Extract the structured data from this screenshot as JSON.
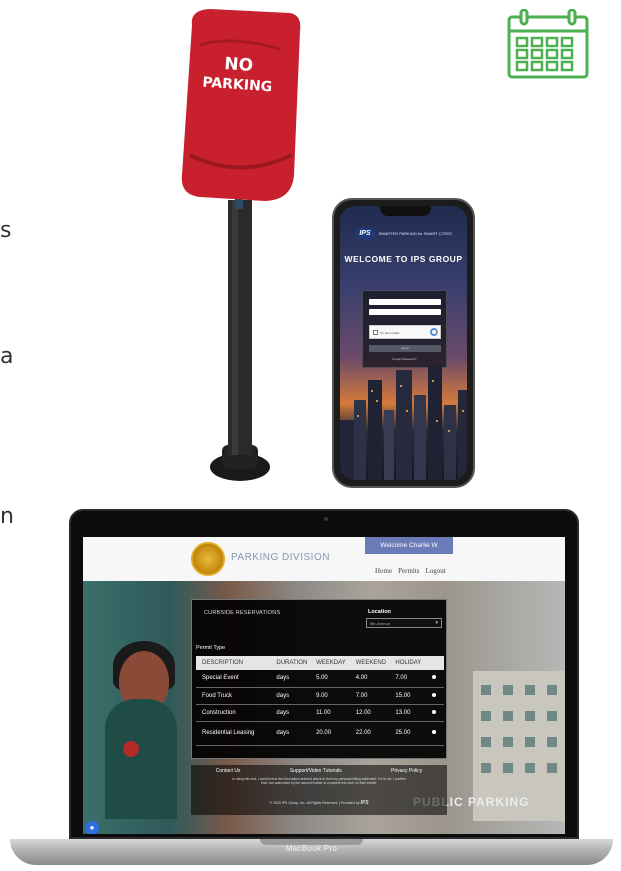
{
  "side_fragments": [
    "s",
    "a",
    "n"
  ],
  "meter_cover": {
    "line1": "NO",
    "line2": "PARKING"
  },
  "phone": {
    "logo": "IPS",
    "tagline": "SMARTER PARKING for SMART CITIES",
    "title": "WELCOME TO IPS GROUP",
    "captcha_text": "I'm not a robot",
    "login_button": "Log In",
    "forgot_link": "Forgot Password?"
  },
  "laptop": {
    "brand_label": "MacBook Pro",
    "site": {
      "division": "PARKING DIVISION",
      "welcome": "Welcome Charlie W",
      "nav": [
        "Home",
        "Permits",
        "Logout"
      ],
      "panel_heading": "CURBSIDE RESERVATIONS",
      "location_label": "Location",
      "location_value": "5th Avenue",
      "permit_type_label": "Permit Type",
      "table_headers": [
        "DESCRIPTION",
        "DURATION",
        "WEEKDAY",
        "WEEKEND",
        "HOLIDAY"
      ],
      "rows": [
        {
          "description": "Special Event",
          "duration": "days",
          "weekday": "5.00",
          "weekend": "4.00",
          "holiday": "7.00"
        },
        {
          "description": "Food Truck",
          "duration": "days",
          "weekday": "9.00",
          "weekend": "7.00",
          "holiday": "15.00"
        },
        {
          "description": "Construction",
          "duration": "days",
          "weekday": "11.00",
          "weekend": "12.00",
          "holiday": "13.00"
        },
        {
          "description": "Residential Leasing",
          "duration": "days",
          "weekday": "20.00",
          "weekend": "22.00",
          "holiday": "25.00"
        }
      ],
      "footer_links": [
        "Contact Us",
        "Support/Video Tutorials",
        "Privacy Policy"
      ],
      "footer_notice": "In using this tool, I confirm that the information entered above is from my personal billing statement. If it is not, I confirm that I am authorized by the account holder to complete this form on their behalf.",
      "footer_copyright": "© 2025 IPS Group, Inc. All Rights Reserved. | Provided by",
      "background_sign": "PUBLIC PARKING"
    }
  },
  "colors": {
    "calendar_green": "#4caf50",
    "cover_red": "#c8202d",
    "welcome_bar": "#6b7bb8",
    "division_text": "#8a95b4"
  }
}
